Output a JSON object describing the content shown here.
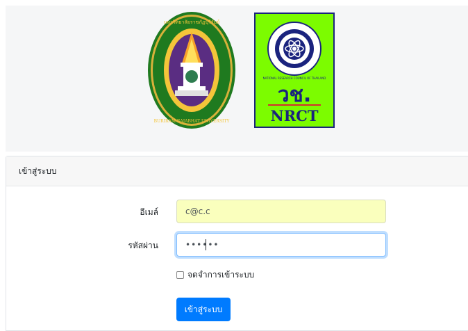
{
  "logos": {
    "bru_text": "BURIRAM RAJABHAT UNIVERSITY",
    "bru_thai_text": "มหาวิทยาลัยราชภัฏบุรีรัมย์",
    "nrct_abbr_thai": "วช.",
    "nrct_abbr": "NRCT",
    "nrct_ring_text": "NATIONAL RESEARCH COUNCIL OF THAILAND"
  },
  "card": {
    "title": "เข้าสู่ระบบ"
  },
  "form": {
    "email_label": "อีเมล์",
    "email_value": "c@c.c",
    "password_label": "รหัสผ่าน",
    "password_value": "••••••",
    "remember_label": "จดจำการเข้าระบบ",
    "submit_label": "เข้าสู่ระบบ"
  },
  "colors": {
    "primary": "#007bff",
    "autofill": "#faffbd",
    "nrct_green": "#7cfc00",
    "nrct_blue": "#1a237e",
    "bru_green": "#1f7a1f",
    "bru_purple": "#5a2d82"
  }
}
